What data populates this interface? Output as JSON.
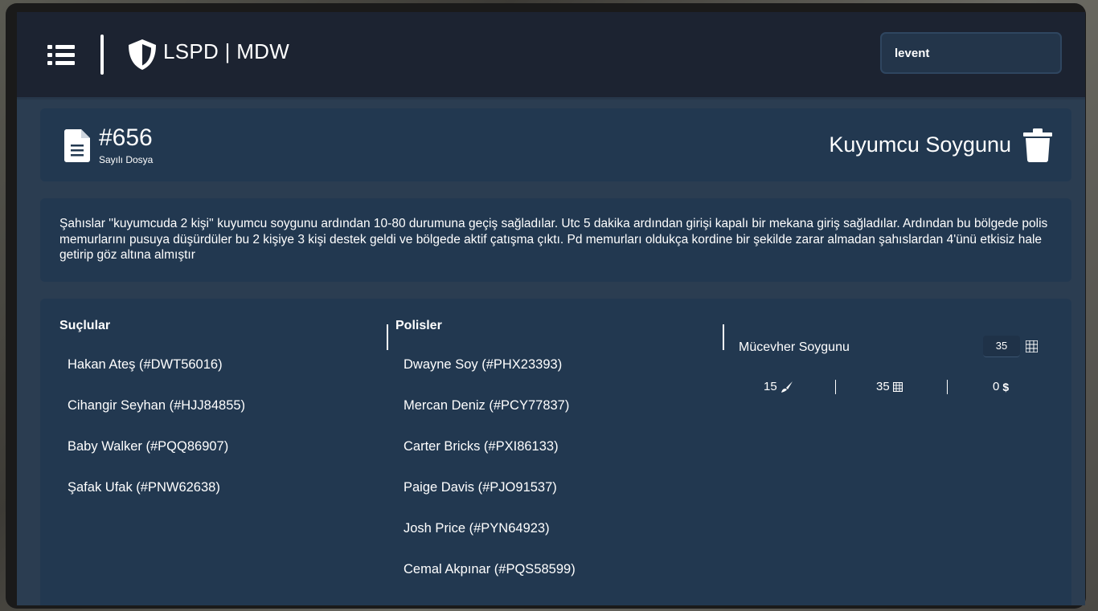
{
  "header": {
    "brand_title": "LSPD | MDW",
    "search_value": "levent"
  },
  "file": {
    "number": "#656",
    "subtitle": "Sayılı Dosya",
    "case_title": "Kuyumcu Soygunu"
  },
  "description": "Şahıslar ''kuyumcuda 2 kişi'' kuyumcu soygunu ardından 10-80 durumuna geçiş sağladılar. Utc 5 dakika ardından girişi kapalı bir mekana giriş sağladılar. Ardından bu bölgede polis memurlarını pusuya düşürdüler bu 2 kişiye 3 kişi destek geldi ve bölgede aktif çatışma çıktı. Pd memurları oldukça kordine bir şekilde zarar almadan şahıslardan 4'ünü etkisiz hale getirip göz altına almıştır",
  "suspects": {
    "title": "Suçlular",
    "items": [
      "Hakan Ateş (#DWT56016)",
      "Cihangir Seyhan (#HJJ84855)",
      "Baby Walker (#PQQ86907)",
      "Şafak Ufak (#PNW62638)"
    ]
  },
  "officers": {
    "title": "Polisler",
    "items": [
      "Dwayne Soy (#PHX23393)",
      "Mercan Deniz (#PCY77837)",
      "Carter Bricks (#PXI86133)",
      "Paige Davis (#PJO91537)",
      "Josh Price (#PYN64923)",
      "Cemal Akpınar (#PQS58599)"
    ]
  },
  "charges": {
    "crime_name": "Mücevher Soygunu",
    "quantity": "35",
    "stats": [
      {
        "value": "15",
        "icon": "brush-icon"
      },
      {
        "value": "35",
        "icon": "grid-icon"
      },
      {
        "value": "0",
        "icon": "dollar-icon"
      }
    ]
  }
}
